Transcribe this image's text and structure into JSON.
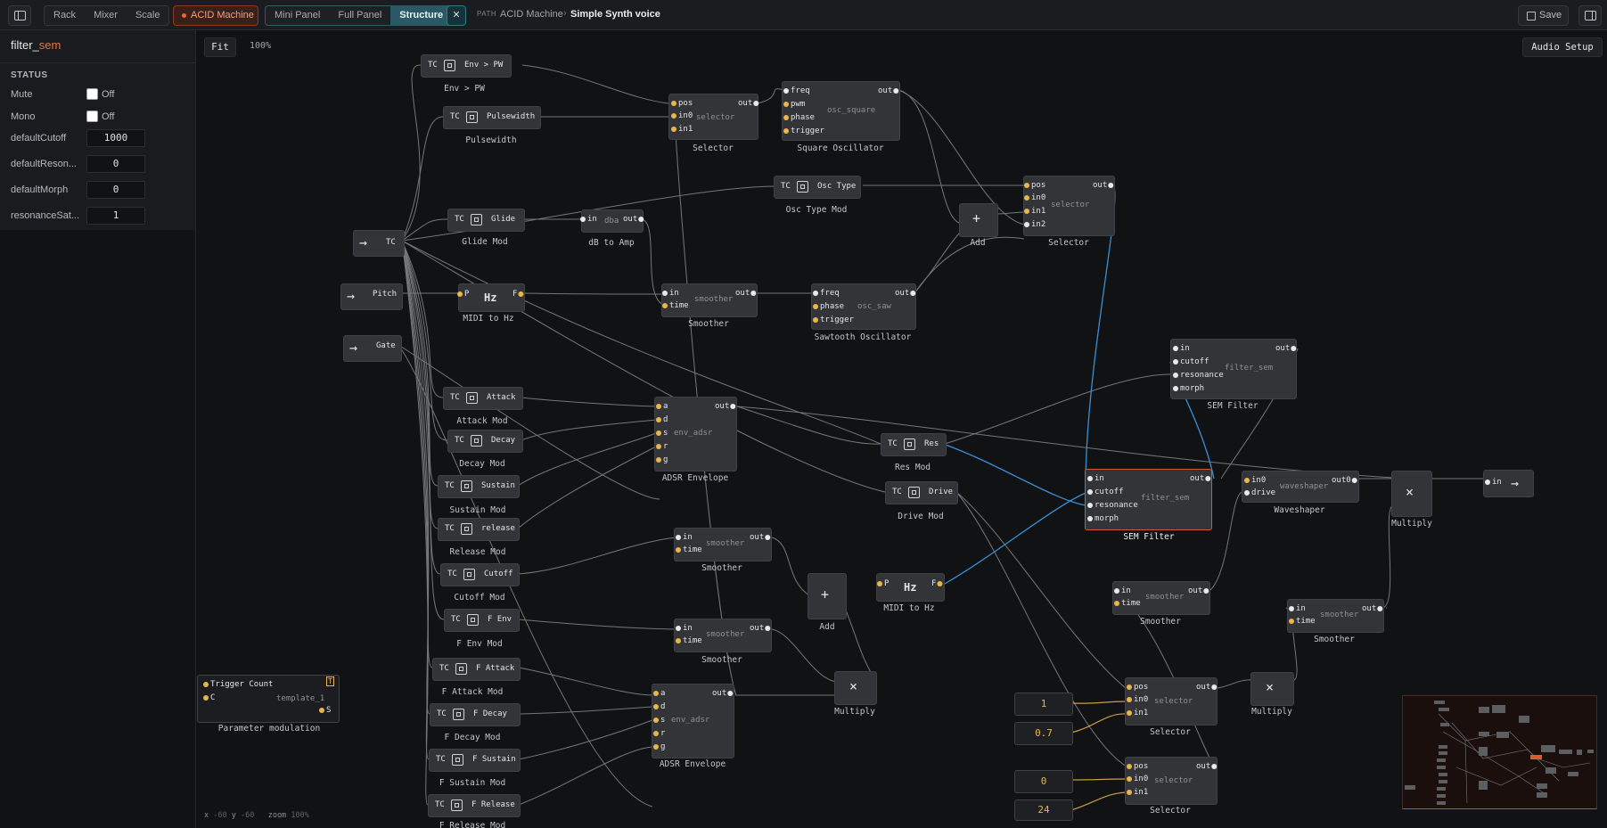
{
  "topbar": {
    "rack": "Rack",
    "mixer": "Mixer",
    "scale": "Scale",
    "acid_machine": "ACID Machine",
    "view_tabs": [
      "Mini Panel",
      "Full Panel",
      "Structure"
    ],
    "path_label": "PATH",
    "path_parent": "ACID Machine",
    "path_sep": "›",
    "path_current": "Simple Synth voice",
    "save": "Save"
  },
  "sidebar": {
    "title_prefix": "filter_",
    "title_accent": "sem",
    "section": "STATUS",
    "mute_label": "Mute",
    "mute_value": "Off",
    "mono_label": "Mono",
    "mono_value": "Off",
    "params": [
      {
        "label": "defaultCutoff",
        "value": "1000"
      },
      {
        "label": "defaultReson...",
        "value": "0"
      },
      {
        "label": "defaultMorph",
        "value": "0"
      },
      {
        "label": "resonanceSat...",
        "value": "1"
      }
    ]
  },
  "canvas": {
    "fit": "Fit",
    "zoom": "100%",
    "audio_setup": "Audio Setup",
    "status_x": "x",
    "status_x_val": "-60",
    "status_y": "y",
    "status_y_val": "-60",
    "status_zoom": "zoom",
    "status_zoom_val": "100%"
  },
  "colors": {
    "accent": "#e8b64a",
    "selected": "#d4572f",
    "wire": "#c7c9cc",
    "wire_blue": "#3a8fd6",
    "active_tab": "#2a5965"
  },
  "inputs": {
    "tc": "TC",
    "pitch": "Pitch",
    "gate": "Gate"
  },
  "tc_mods": [
    {
      "name": "Env > PW",
      "label": "Env > PW"
    },
    {
      "name": "Pulsewidth",
      "label": "Pulsewidth"
    },
    {
      "name": "Glide",
      "label": "Glide Mod"
    },
    {
      "name": "Attack",
      "label": "Attack Mod"
    },
    {
      "name": "Decay",
      "label": "Decay Mod"
    },
    {
      "name": "Sustain",
      "label": "Sustain Mod"
    },
    {
      "name": "release",
      "label": "Release Mod"
    },
    {
      "name": "Cutoff",
      "label": "Cutoff Mod"
    },
    {
      "name": "F Env",
      "label": "F Env Mod"
    },
    {
      "name": "F Attack",
      "label": "F Attack Mod"
    },
    {
      "name": "F Decay",
      "label": "F Decay Mod"
    },
    {
      "name": "F Sustain",
      "label": "F Sustain Mod"
    },
    {
      "name": "F Release",
      "label": "F Release Mod"
    },
    {
      "name": "Osc Type",
      "label": "Osc Type Mod"
    },
    {
      "name": "Res",
      "label": "Res Mod"
    },
    {
      "name": "Drive",
      "label": "Drive Mod"
    }
  ],
  "tc_tag": "TC",
  "nodes": {
    "midi_hz": {
      "title": "Hz",
      "p": "P",
      "f": "F",
      "label": "MIDI to Hz"
    },
    "dba": {
      "title": "dba",
      "in": "in",
      "out": "out",
      "label": "dB to Amp"
    },
    "selector1": {
      "title": "selector",
      "ports": [
        "pos",
        "in0",
        "in1"
      ],
      "out": "out",
      "label": "Selector"
    },
    "osc_square": {
      "title": "osc_square",
      "ports": [
        "freq",
        "pwm",
        "phase",
        "trigger"
      ],
      "out": "out",
      "label": "Square Oscillator"
    },
    "smoother1": {
      "title": "smoother",
      "ports": [
        "in",
        "time"
      ],
      "out": "out",
      "label": "Smoother"
    },
    "osc_saw": {
      "title": "osc_saw",
      "ports": [
        "freq",
        "phase",
        "trigger"
      ],
      "out": "out",
      "label": "Sawtooth Oscillator"
    },
    "add1": {
      "symbol": "+",
      "label": "Add"
    },
    "selector2": {
      "title": "selector",
      "ports": [
        "pos",
        "in0",
        "in1",
        "in2"
      ],
      "out": "out",
      "label": "Selector"
    },
    "adsr1": {
      "title": "env_adsr",
      "ports": [
        "a",
        "d",
        "s",
        "r",
        "g"
      ],
      "out": "out",
      "label": "ADSR Envelope"
    },
    "filter1": {
      "title": "filter_sem",
      "ports": [
        "in",
        "cutoff",
        "resonance",
        "morph"
      ],
      "out": "out",
      "label": "SEM Filter"
    },
    "filter2": {
      "title": "filter_sem",
      "ports": [
        "in",
        "cutoff",
        "resonance",
        "morph"
      ],
      "out": "out",
      "label": "SEM Filter"
    },
    "waveshaper": {
      "title": "waveshaper",
      "ports": [
        "in0",
        "drive"
      ],
      "out": "out0",
      "label": "Waveshaper"
    },
    "multiply1": {
      "symbol": "×",
      "label": "Multiply"
    },
    "out_node": {
      "in": "in"
    },
    "smoother2": {
      "title": "smoother",
      "ports": [
        "in",
        "time"
      ],
      "out": "out",
      "label": "Smoother"
    },
    "smoother3": {
      "title": "smoother",
      "ports": [
        "in",
        "time"
      ],
      "out": "out",
      "label": "Smoother"
    },
    "add2": {
      "symbol": "+",
      "label": "Add"
    },
    "midi_hz2": {
      "title": "Hz",
      "p": "P",
      "f": "F",
      "label": "MIDI to Hz"
    },
    "multiply2": {
      "symbol": "×",
      "label": "Multiply"
    },
    "adsr2": {
      "title": "env_adsr",
      "ports": [
        "a",
        "d",
        "s",
        "r",
        "g"
      ],
      "out": "out",
      "label": "ADSR Envelope"
    },
    "smoother4": {
      "title": "smoother",
      "ports": [
        "in",
        "time"
      ],
      "out": "out",
      "label": "Smoother"
    },
    "smoother5": {
      "title": "smoother",
      "ports": [
        "in",
        "time"
      ],
      "out": "out",
      "label": "Smoother"
    },
    "selector3": {
      "title": "selector",
      "ports": [
        "pos",
        "in0",
        "in1"
      ],
      "out": "out",
      "label": "Selector"
    },
    "selector4": {
      "title": "selector",
      "ports": [
        "pos",
        "in0",
        "in1"
      ],
      "out": "out",
      "label": "Selector"
    },
    "multiply3": {
      "symbol": "×",
      "label": "Multiply"
    },
    "num1": {
      "value": "1"
    },
    "num2": {
      "value": "0.7"
    },
    "num3": {
      "value": "0"
    },
    "num4": {
      "value": "24"
    },
    "param_mod": {
      "title": "Trigger Count",
      "c": "C",
      "tmpl": "template_1",
      "s": "S",
      "t": "T",
      "label": "Parameter modulation"
    }
  }
}
